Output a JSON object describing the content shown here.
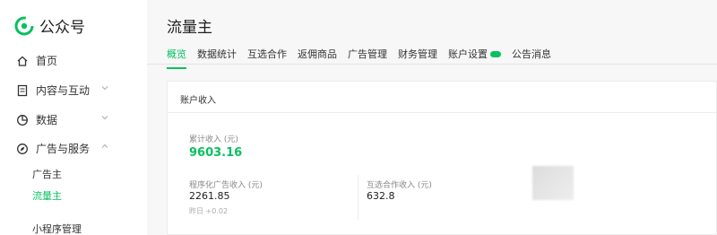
{
  "brand": {
    "name": "公众号"
  },
  "sidebar": {
    "home": "首页",
    "content": "内容与互动",
    "data": "数据",
    "ads": "广告与服务",
    "sub_advertiser": "广告主",
    "sub_publisher": "流量主",
    "sub_miniprogram": "小程序管理"
  },
  "page": {
    "title": "流量主",
    "tabs": [
      "概览",
      "数据统计",
      "互选合作",
      "返佣商品",
      "广告管理",
      "财务管理",
      "账户设置",
      "公告消息"
    ],
    "active_tab": "概览"
  },
  "card": {
    "title": "账户收入",
    "total_label": "累计收入 (元)",
    "total_value": "9603.16",
    "programmatic_label": "程序化广告收入 (元)",
    "programmatic_value": "2261.85",
    "programmatic_note": "昨日 +0.02",
    "mutual_label": "互选合作收入 (元)",
    "mutual_value": "632.8"
  },
  "colors": {
    "accent": "#07c160"
  }
}
